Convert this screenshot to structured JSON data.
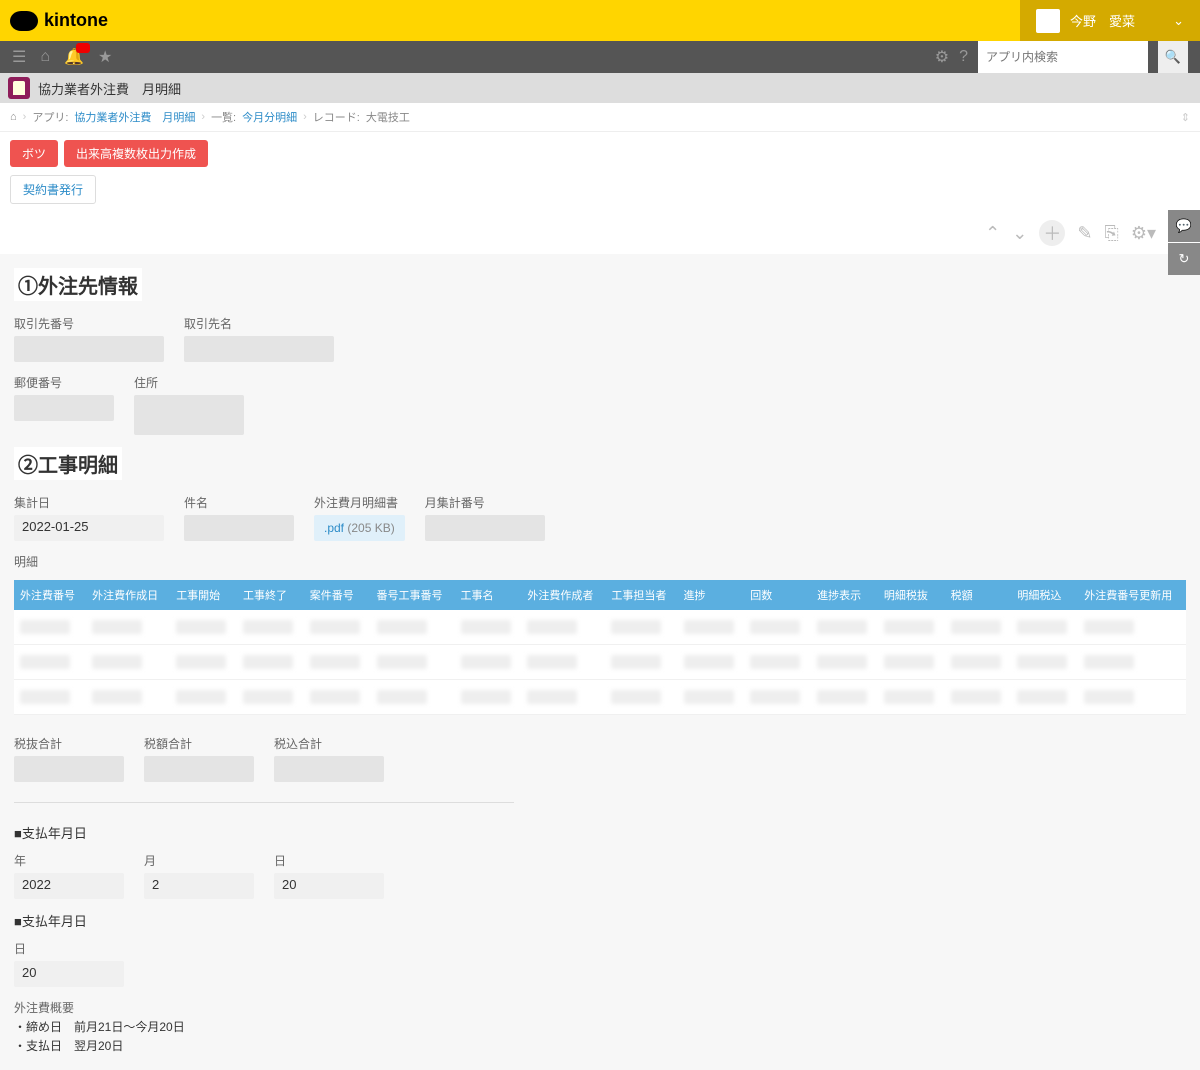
{
  "brand": "kintone",
  "user": {
    "name": "今野　愛菜"
  },
  "search": {
    "placeholder": "アプリ内検索"
  },
  "app": {
    "title": "協力業者外注費　月明細"
  },
  "breadcrumb": {
    "app_prefix": "アプリ:",
    "app_link": "協力業者外注費　月明細",
    "view_prefix": "一覧:",
    "view_link": "今月分明細",
    "record_prefix": "レコード:",
    "record": "大電技工"
  },
  "buttons": {
    "botsu": "ボツ",
    "dekidaka": "出来高複数枚出力作成",
    "keiyaku": "契約書発行"
  },
  "section1": {
    "title": "①外注先情報",
    "labels": {
      "partner_no": "取引先番号",
      "partner_name": "取引先名",
      "postal": "郵便番号",
      "address": "住所"
    }
  },
  "section2": {
    "title": "②工事明細",
    "labels": {
      "aggregate_date": "集計日",
      "subject": "件名",
      "monthly_doc": "外注費月明細書",
      "monthly_no": "月集計番号",
      "detail": "明細"
    },
    "aggregate_date": "2022-01-25",
    "file": {
      "name": ".pdf",
      "size": "(205 KB)"
    },
    "columns": [
      "外注費番号",
      "外注費作成日",
      "工事開始",
      "工事終了",
      "案件番号",
      "番号工事番号",
      "工事名",
      "外注費作成者",
      "工事担当者",
      "進捗",
      "回数",
      "進捗表示",
      "明細税抜",
      "税額",
      "明細税込",
      "外注費番号更新用"
    ],
    "rows": 3,
    "totals": {
      "zeinuki": "税抜合計",
      "zeigaku": "税額合計",
      "zeikomi": "税込合計"
    }
  },
  "payment": {
    "heading1": "■支払年月日",
    "heading2": "■支払年月日",
    "labels": {
      "year": "年",
      "month": "月",
      "day": "日"
    },
    "year": "2022",
    "month": "2",
    "day": "20",
    "day2": "20"
  },
  "summary": {
    "title": "外注費概要",
    "line1": "・締め日　前月21日～今月20日",
    "line2": "・支払日　翌月20日"
  }
}
